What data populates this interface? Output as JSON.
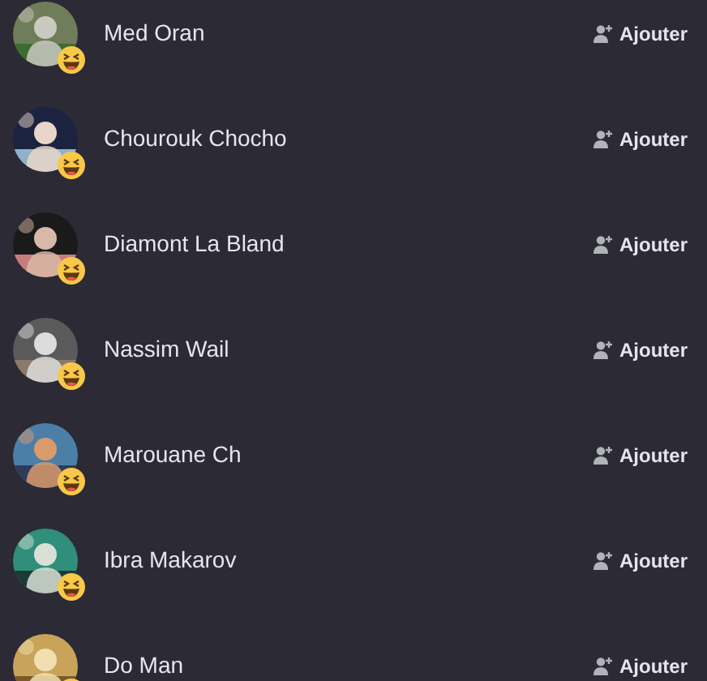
{
  "people": [
    {
      "name": "Med Oran",
      "button": "Ajouter"
    },
    {
      "name": "Chourouk Chocho",
      "button": "Ajouter"
    },
    {
      "name": "Diamont La Bland",
      "button": "Ajouter"
    },
    {
      "name": "Nassim Wail",
      "button": "Ajouter"
    },
    {
      "name": "Marouane Ch",
      "button": "Ajouter"
    },
    {
      "name": "Ibra Makarov",
      "button": "Ajouter"
    },
    {
      "name": "Do Man",
      "button": "Ajouter"
    }
  ]
}
